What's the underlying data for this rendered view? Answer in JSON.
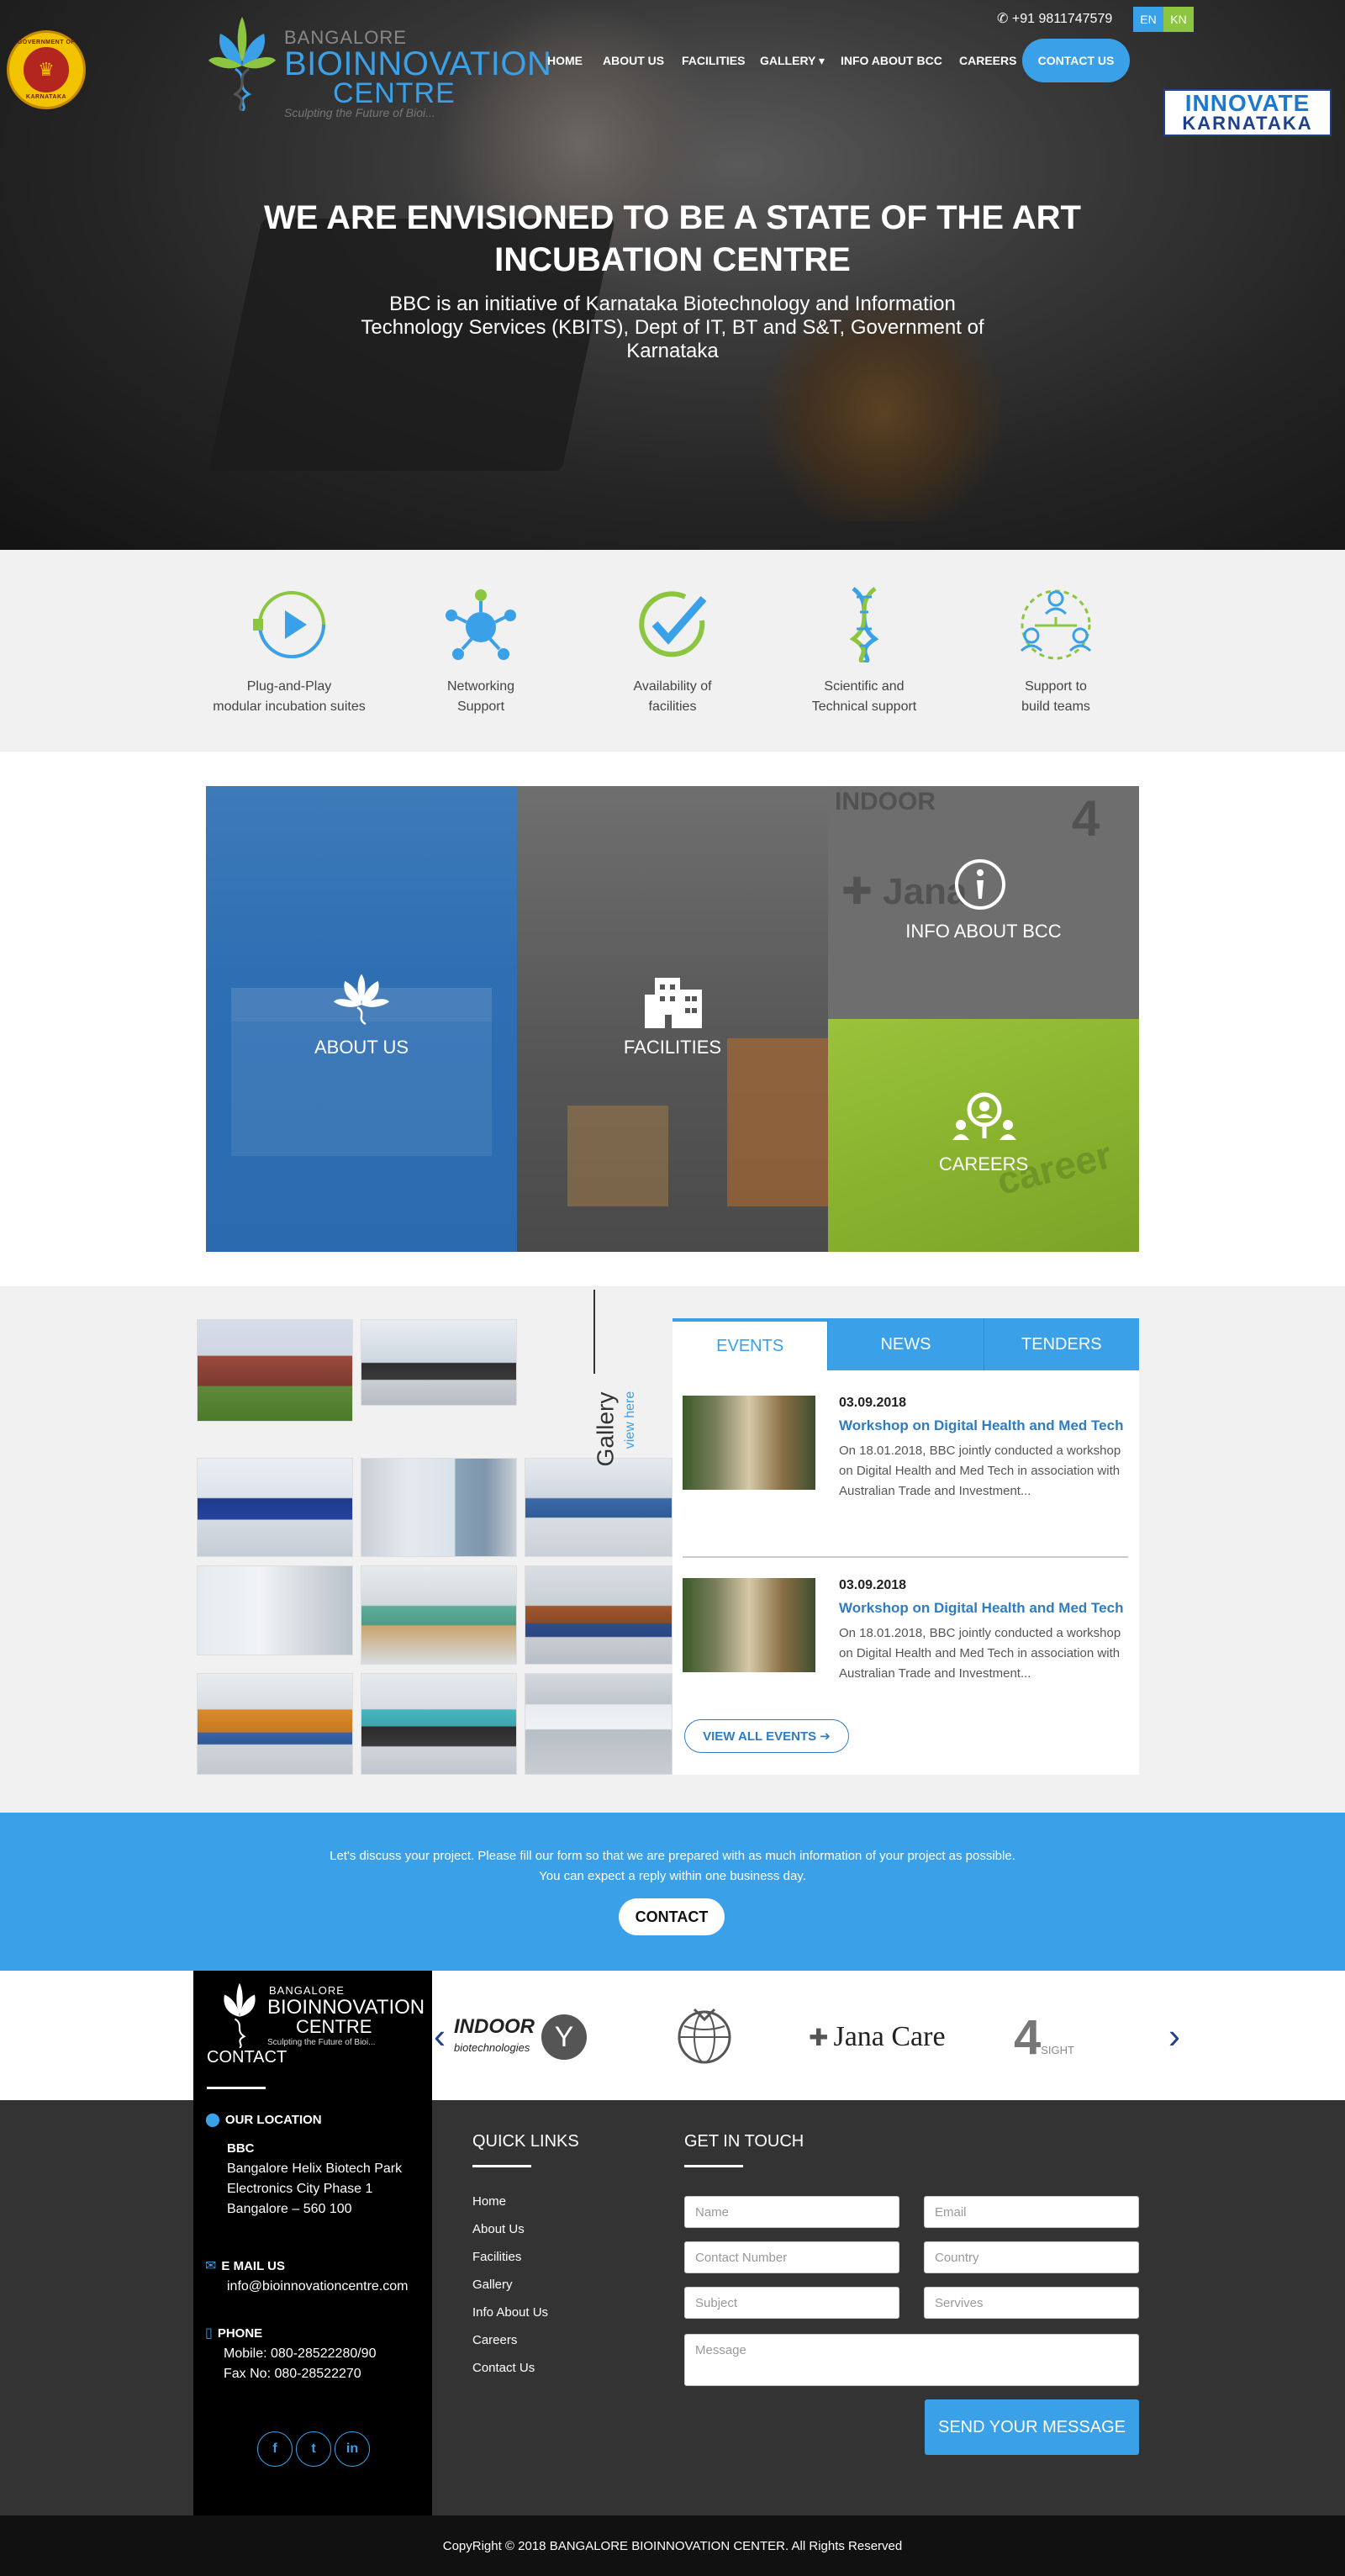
{
  "header": {
    "phone": "+91 9811747579",
    "lang_en": "EN",
    "lang_kn": "KN",
    "gov_seal_text_top": "GOVERNMENT OF",
    "gov_seal_text_bottom": "KARNATAKA",
    "logo": {
      "line1": "BANGALORE",
      "line2": "BIOINNOVATION",
      "line3": "CENTRE",
      "tagline": "Sculpting the Future of Bioi..."
    },
    "nav": [
      "HOME",
      "ABOUT US",
      "FACILITIES",
      "GALLERY ▾",
      "INFO ABOUT BCC",
      "CAREERS"
    ],
    "contact_button": "CONTACT US",
    "innovate": {
      "line1": "INNOVATE",
      "line2": "KARNATAKA"
    }
  },
  "hero": {
    "title": "WE ARE ENVISIONED TO BE A STATE OF THE ART INCUBATION CENTRE",
    "subtitle": "BBC is an initiative of Karnataka Biotechnology and Information Technology Services (KBITS), Dept of IT, BT and S&T, Government of Karnataka"
  },
  "features": [
    {
      "line1": "Plug-and-Play",
      "line2": "modular incubation suites",
      "icon": "play-plug-icon"
    },
    {
      "line1": "Networking",
      "line2": "Support",
      "icon": "network-icon"
    },
    {
      "line1": "Availability of",
      "line2": "facilities",
      "icon": "check-icon"
    },
    {
      "line1": "Scientific and",
      "line2": "Technical support",
      "icon": "dna-icon"
    },
    {
      "line1": "Support to",
      "line2": "build teams",
      "icon": "team-icon"
    }
  ],
  "tiles": {
    "about": "ABOUT US",
    "facilities": "FACILITIES",
    "info": "INFO ABOUT BCC",
    "careers": "CAREERS"
  },
  "gallery": {
    "title": "Gallery",
    "view": "view here"
  },
  "events": {
    "tabs": [
      "EVENTS",
      "NEWS",
      "TENDERS"
    ],
    "items": [
      {
        "date": "03.09.2018",
        "title": "Workshop on Digital Health and Med Tech",
        "desc": "On 18.01.2018, BBC jointly conducted a workshop on Digital Health and Med Tech in association with Australian Trade and Investment..."
      },
      {
        "date": "03.09.2018",
        "title": "Workshop on Digital Health and Med Tech",
        "desc": "On 18.01.2018, BBC jointly conducted a workshop on Digital Health and Med Tech in association with Australian Trade and Investment..."
      }
    ],
    "view_all": "VIEW ALL EVENTS ➔"
  },
  "cta": {
    "message": "Let's discuss your project. Please fill our form so that we are prepared with as much information of your project as possible. You can expect a reply within one business day.",
    "button": "CONTACT"
  },
  "partners": [
    "INDOOR biotechnologies",
    "Jana Care",
    "4SIGHT"
  ],
  "footer": {
    "contact_title": "CONTACT",
    "location_heading": "OUR LOCATION",
    "location_name": "BBC",
    "location_lines": [
      "Bangalore Helix Biotech Park",
      "Electronics City Phase 1",
      "Bangalore – 560 100"
    ],
    "email_heading": "E MAIL US",
    "email": "info@bioinnovationcentre.com",
    "phone_heading": "PHONE",
    "mobile": "Mobile: 080-28522280/90",
    "fax": "Fax No: 080-28522270",
    "socials": [
      "f",
      "t",
      "in"
    ],
    "quick_links_title": "QUICK LINKS",
    "quick_links": [
      "Home",
      "About Us",
      "Facilities",
      "Gallery",
      "Info About Us",
      "Careers",
      "Contact Us"
    ],
    "git_title": "GET IN TOUCH",
    "form": {
      "name": "Name",
      "email": "Email",
      "contact": "Contact Number",
      "country": "Country",
      "subject": "Subject",
      "services": "Servives",
      "message": "Message",
      "send": "SEND YOUR MESSAGE"
    },
    "copyright": "CopyRight © 2018 BANGALORE BIOINNOVATION CENTER. All Rights Reserved"
  },
  "colors": {
    "accent": "#3aa0e8",
    "green": "#8cc640",
    "dark": "#333333"
  }
}
